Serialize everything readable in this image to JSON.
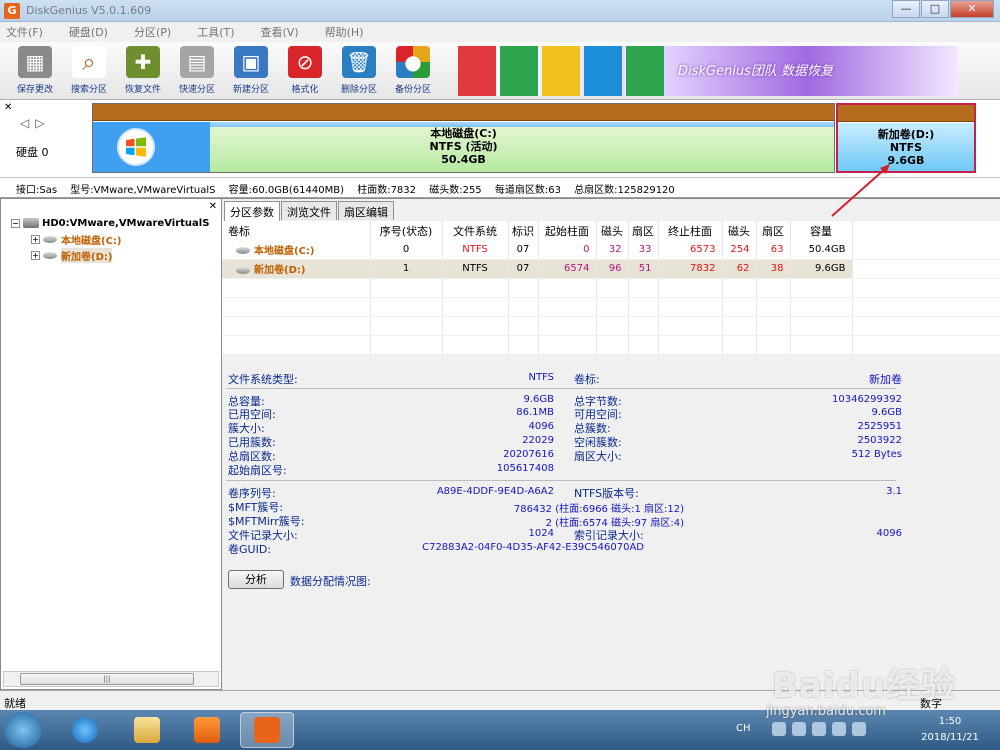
{
  "window": {
    "title": "DiskGenius V5.0.1.609",
    "minimize": "—",
    "maximize": "□",
    "close": "✕"
  },
  "menu": [
    "文件(F)",
    "硬盘(D)",
    "分区(P)",
    "工具(T)",
    "查看(V)",
    "帮助(H)"
  ],
  "toolbar": [
    {
      "label": "保存更改",
      "icon": "save-icon",
      "color": "#7d7d7d"
    },
    {
      "label": "搜索分区",
      "icon": "search-icon",
      "color": "#b7683a"
    },
    {
      "label": "恢复文件",
      "icon": "recover-icon",
      "color": "#6f8f2f"
    },
    {
      "label": "快速分区",
      "icon": "quick-partition-icon",
      "color": "#9a9a9a"
    },
    {
      "label": "新建分区",
      "icon": "new-partition-icon",
      "color": "#3a79c2"
    },
    {
      "label": "格式化",
      "icon": "format-icon",
      "color": "#d9252a"
    },
    {
      "label": "删除分区",
      "icon": "delete-icon",
      "color": "#2a7fc2"
    },
    {
      "label": "备份分区",
      "icon": "backup-icon",
      "color": "#e5a51b"
    }
  ],
  "banner": {
    "text": "DiskGenius团队 数据恢复"
  },
  "disk_map": {
    "disk_label": "硬盘 0",
    "c": {
      "name": "本地磁盘(C:)",
      "fs": "NTFS (活动)",
      "size": "50.4GB"
    },
    "d": {
      "name": "新加卷(D:)",
      "fs": "NTFS",
      "size": "9.6GB"
    }
  },
  "disk_info": [
    "接口:Sas",
    "型号:VMware,VMwareVirtualS",
    "容量:60.0GB(61440MB)",
    "柱面数:7832",
    "磁头数:255",
    "每道扇区数:63",
    "总扇区数:125829120"
  ],
  "tree": {
    "disk": "HD0:VMware,VMwareVirtualS",
    "c": "本地磁盘(C:)",
    "d": "新加卷(D:)",
    "scroll_grip": "|||"
  },
  "tabs": [
    "分区参数",
    "浏览文件",
    "扇区编辑"
  ],
  "table": {
    "headers": [
      "卷标",
      "序号(状态)",
      "文件系统",
      "标识",
      "起始柱面",
      "磁头",
      "扇区",
      "终止柱面",
      "磁头",
      "扇区",
      "容量"
    ],
    "rows": [
      [
        "本地磁盘(C:)",
        "0",
        "NTFS",
        "07",
        "0",
        "32",
        "33",
        "6573",
        "254",
        "63",
        "50.4GB"
      ],
      [
        "新加卷(D:)",
        "1",
        "NTFS",
        "07",
        "6574",
        "96",
        "51",
        "7832",
        "62",
        "38",
        "9.6GB"
      ]
    ]
  },
  "details": {
    "fs_type_label": "文件系统类型:",
    "fs_type": "NTFS",
    "vol_label_label": "卷标:",
    "vol_label": "新加卷",
    "left": [
      [
        "总容量:",
        "9.6GB"
      ],
      [
        "已用空间:",
        "86.1MB"
      ],
      [
        "簇大小:",
        "4096"
      ],
      [
        "已用簇数:",
        "22029"
      ],
      [
        "总扇区数:",
        "20207616"
      ],
      [
        "起始扇区号:",
        "105617408"
      ]
    ],
    "right": [
      [
        "总字节数:",
        "10346299392"
      ],
      [
        "可用空间:",
        "9.6GB"
      ],
      [
        "总簇数:",
        "2525951"
      ],
      [
        "空闲簇数:",
        "2503922"
      ],
      [
        "扇区大小:",
        "512 Bytes"
      ]
    ],
    "serial_label": "卷序列号:",
    "serial": "A89E-4DDF-9E4D-A6A2",
    "ntfs_ver_label": "NTFS版本号:",
    "ntfs_ver": "3.1",
    "mft_label": "$MFT簇号:",
    "mft": "786432 (柱面:6966 磁头:1 扇区:12)",
    "mftmirr_label": "$MFTMirr簇号:",
    "mftmirr": "2 (柱面:6574 磁头:97 扇区:4)",
    "rec_label": "文件记录大小:",
    "rec": "1024",
    "idx_label": "索引记录大小:",
    "idx": "4096",
    "guid_label": "卷GUID:",
    "guid": "C72883A2-04F0-4D35-AF42-E39C546070AD",
    "analyze": "分析",
    "distro": "数据分配情况图:"
  },
  "status": {
    "left": "就绪",
    "right": "数字"
  },
  "taskbar": {
    "lang": "CH",
    "time": "1:50",
    "date": "2018/11/21"
  },
  "watermark": {
    "brand": "Baidu经验",
    "url": "jingyan.baidu.com"
  }
}
